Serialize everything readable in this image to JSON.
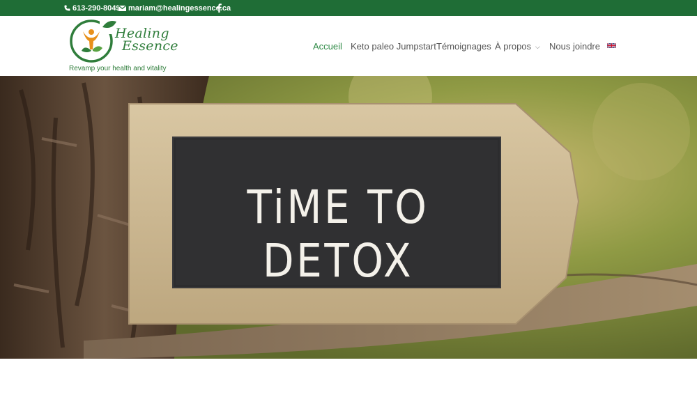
{
  "topbar": {
    "phone": "613-290-8049",
    "email": "mariam@healingessence.ca",
    "phone_icon": "phone-icon",
    "email_icon": "envelope-icon",
    "social_icon": "facebook-icon",
    "bg_color": "#1f6d36"
  },
  "logo": {
    "line1": "Healing",
    "line2": "Essence",
    "tagline": "Revamp your health and vitality",
    "brand_color": "#2f7d3b"
  },
  "nav": {
    "items": [
      {
        "label": "Accueil",
        "active": true
      },
      {
        "label": "Keto paleo Jumpstart",
        "active": false
      },
      {
        "label": "Témoignages",
        "active": false
      },
      {
        "label": "À propos",
        "active": false,
        "has_dropdown": true
      },
      {
        "label": "Nous joindre",
        "active": false
      }
    ],
    "language_icon": "uk-flag-icon",
    "active_color": "#2f8a46"
  },
  "hero": {
    "sign_text": "TiME TO DETOX"
  }
}
